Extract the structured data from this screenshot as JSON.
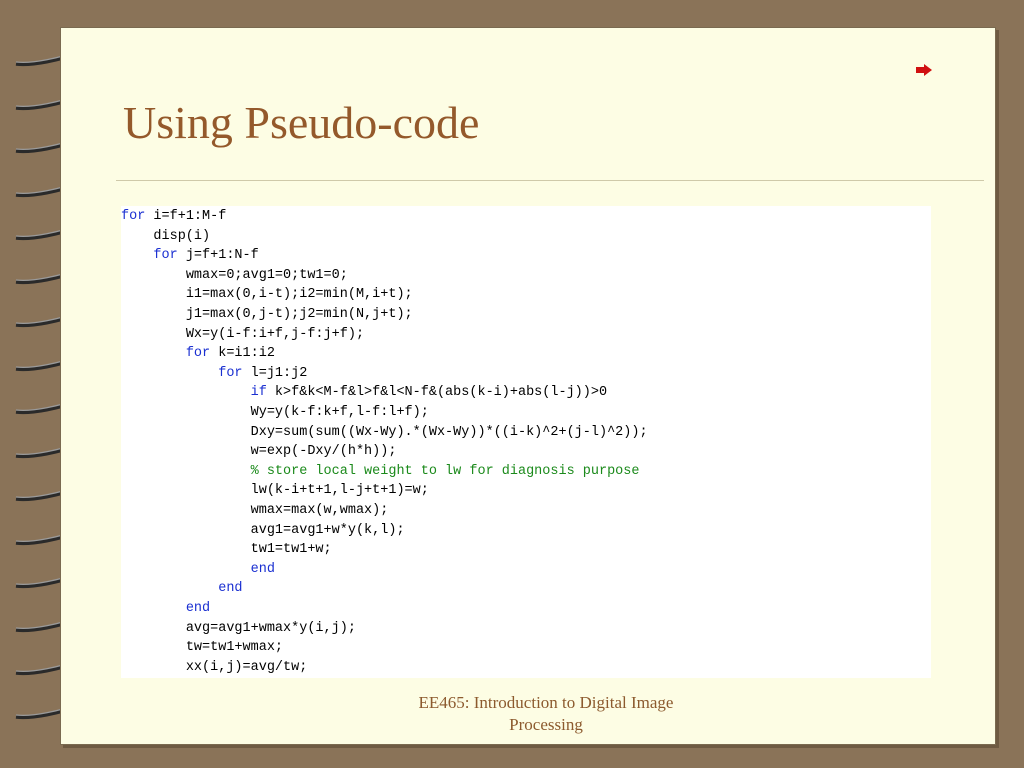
{
  "slide": {
    "title": "Using Pseudo-code",
    "footer_line1": "EE465: Introduction to Digital Image",
    "footer_line2": "Processing",
    "nav_icon": "red-arrow-right-icon"
  },
  "colors": {
    "page_background": "#fdfde4",
    "frame_background": "#8a7358",
    "title": "#94592b",
    "keyword": "#1a2fd1",
    "comment": "#1b8a1b",
    "nav_arrow": "#d01010"
  },
  "code": {
    "lines": [
      {
        "kw": "for",
        "text": " i=f+1:M-f",
        "indent": ""
      },
      {
        "kw": "",
        "text": "disp(i)",
        "indent": "    "
      },
      {
        "kw": "for",
        "text": " j=f+1:N-f",
        "indent": "    "
      },
      {
        "kw": "",
        "text": "wmax=0;avg1=0;tw1=0;",
        "indent": "        "
      },
      {
        "kw": "",
        "text": "i1=max(0,i-t);i2=min(M,i+t);",
        "indent": "        "
      },
      {
        "kw": "",
        "text": "j1=max(0,j-t);j2=min(N,j+t);",
        "indent": "        "
      },
      {
        "kw": "",
        "text": "Wx=y(i-f:i+f,j-f:j+f);",
        "indent": "        "
      },
      {
        "kw": "for",
        "text": " k=i1:i2",
        "indent": "        "
      },
      {
        "kw": "for",
        "text": " l=j1:j2",
        "indent": "            "
      },
      {
        "kw": "if",
        "text": " k>f&k<M-f&l>f&l<N-f&(abs(k-i)+abs(l-j))>0",
        "indent": "                "
      },
      {
        "kw": "",
        "text": "Wy=y(k-f:k+f,l-f:l+f);",
        "indent": "                "
      },
      {
        "kw": "",
        "text": "Dxy=sum(sum((Wx-Wy).*(Wx-Wy))*((i-k)^2+(j-l)^2));",
        "indent": "                "
      },
      {
        "kw": "",
        "text": "w=exp(-Dxy/(h*h));",
        "indent": "                "
      },
      {
        "kw": "",
        "cm": "% store local weight to lw for diagnosis purpose",
        "text": "",
        "indent": "                "
      },
      {
        "kw": "",
        "text": "lw(k-i+t+1,l-j+t+1)=w;",
        "indent": "                "
      },
      {
        "kw": "",
        "text": "wmax=max(w,wmax);",
        "indent": "                "
      },
      {
        "kw": "",
        "text": "avg1=avg1+w*y(k,l);",
        "indent": "                "
      },
      {
        "kw": "",
        "text": "tw1=tw1+w;",
        "indent": "                "
      },
      {
        "kw": "end",
        "text": "",
        "indent": "                "
      },
      {
        "kw": "end",
        "text": "",
        "indent": "            "
      },
      {
        "kw": "end",
        "text": "",
        "indent": "        "
      },
      {
        "kw": "",
        "text": "avg=avg1+wmax*y(i,j);",
        "indent": "        "
      },
      {
        "kw": "",
        "text": "tw=tw1+wmax;",
        "indent": "        "
      },
      {
        "kw": "",
        "text": "xx(i,j)=avg/tw;",
        "indent": "        "
      }
    ]
  }
}
